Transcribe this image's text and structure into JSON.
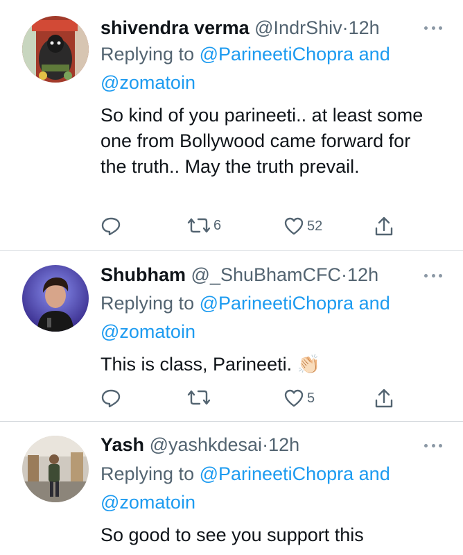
{
  "tweets": [
    {
      "name": "shivendra verma",
      "handle": "@IndrShiv",
      "time": "12h",
      "dot": "·",
      "reply_prefix": "Replying to",
      "mention_1": "@ParineetiChopra",
      "mention_conj": "and",
      "mention_2": "@zomatoin",
      "text": "So kind of you parineeti.. at least some one from Bollywood  came forward for the truth.. May the truth prevail.",
      "retweets": "6",
      "likes": "52"
    },
    {
      "name": "Shubham",
      "handle": "@_ShuBhamCFC",
      "time": "12h",
      "dot": "·",
      "reply_prefix": "Replying to",
      "mention_1": "@ParineetiChopra",
      "mention_conj": "and",
      "mention_2": "@zomatoin",
      "text": "This is class, Parineeti.",
      "emoji": "👏🏻",
      "retweets": "",
      "likes": "5"
    },
    {
      "name": "Yash",
      "handle": "@yashkdesai",
      "time": "12h",
      "dot": "·",
      "reply_prefix": "Replying to",
      "mention_1": "@ParineetiChopra",
      "mention_conj": "and",
      "mention_2": "@zomatoin",
      "text": "So good to see you support this"
    }
  ],
  "icons": {
    "reply": "reply-icon",
    "retweet": "retweet-icon",
    "like": "heart-icon",
    "share": "share-icon",
    "more": "more-icon"
  },
  "colors": {
    "link": "#1d9bf0",
    "secondary_text": "#536471",
    "divider": "#d7dbdf"
  }
}
